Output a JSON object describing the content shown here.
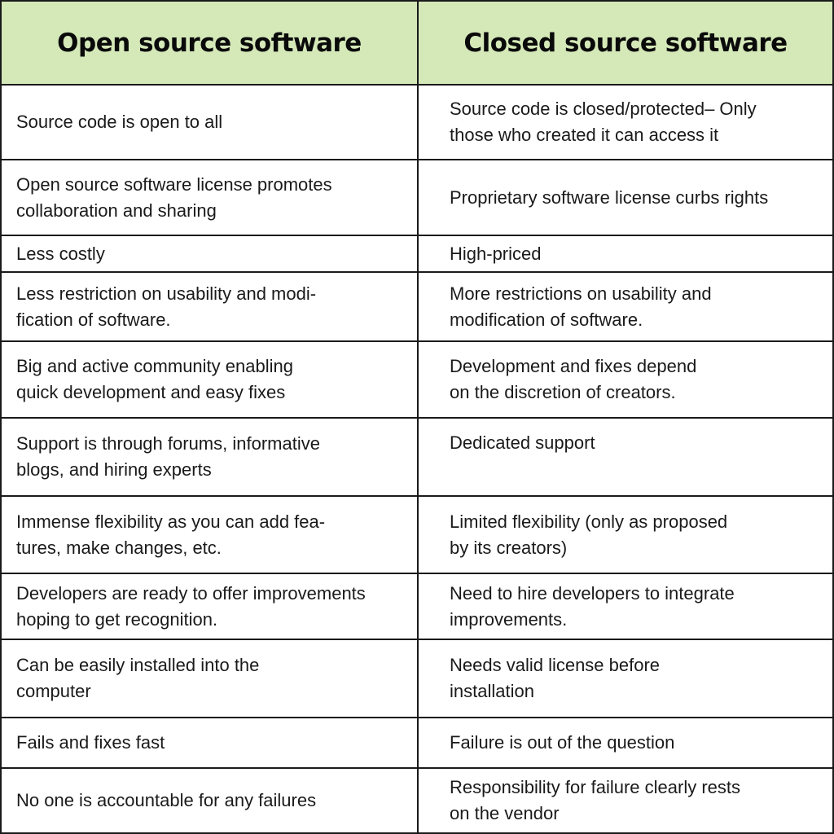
{
  "headers": {
    "open": "Open source software",
    "closed": "Closed source software"
  },
  "header_bg_color": "#d4e8b8",
  "rows": [
    {
      "open": "Source code is open to all",
      "closed": "Source code is closed/protected– Only\nthose who created it can access it"
    },
    {
      "open": "Open source software license promotes\ncollaboration and sharing",
      "closed": "Proprietary software license curbs rights"
    },
    {
      "open": "Less costly",
      "closed": "High-priced"
    },
    {
      "open": "Less restriction on usability and modi-\nfication of software.",
      "closed": "More restrictions on usability and\nmodification of software."
    },
    {
      "open": "Big and active community enabling\nquick development and easy fixes",
      "closed": "Development and fixes depend\non the discretion of creators."
    },
    {
      "open": "Support is through forums, informative\nblogs, and hiring experts",
      "closed": "Dedicated support"
    },
    {
      "open": "Immense flexibility as you can add fea-\ntures, make changes, etc.",
      "closed": "Limited flexibility (only as proposed\nby its creators)"
    },
    {
      "open": "Developers are ready to offer improvements\nhoping to get recognition.",
      "closed": "Need to hire developers to integrate\nimprovements."
    },
    {
      "open": "Can be easily installed into the\ncomputer",
      "closed": "Needs valid license before\ninstallation"
    },
    {
      "open": "Fails and fixes fast",
      "closed": "Failure is out of the question"
    },
    {
      "open": "No one is accountable for any failures",
      "closed": "Responsibility for failure clearly rests\non the vendor"
    }
  ]
}
